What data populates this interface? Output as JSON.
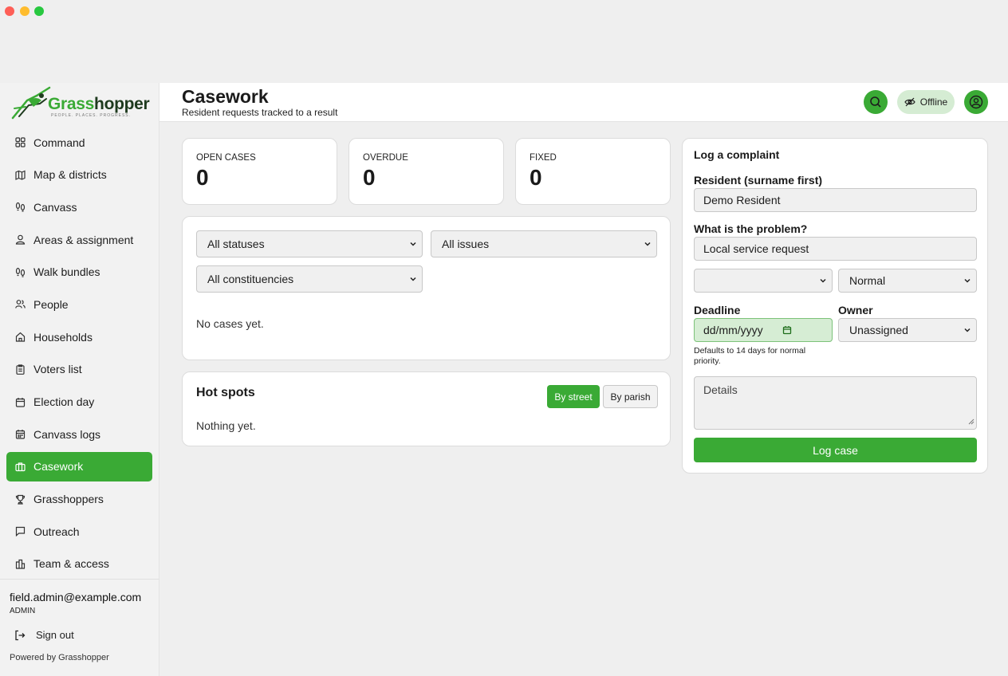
{
  "app": {
    "logo_text_accent": "Grass",
    "logo_text_main": "hopper",
    "logo_tagline": "PEOPLE. PLACES. PROGRESS."
  },
  "sidebar": {
    "items": [
      {
        "label": "Command",
        "icon": "grid-icon"
      },
      {
        "label": "Map & districts",
        "icon": "map-icon"
      },
      {
        "label": "Canvass",
        "icon": "footprints-icon"
      },
      {
        "label": "Areas & assignment",
        "icon": "user-pin-icon"
      },
      {
        "label": "Walk bundles",
        "icon": "footprints-icon"
      },
      {
        "label": "People",
        "icon": "users-icon"
      },
      {
        "label": "Households",
        "icon": "home-icon"
      },
      {
        "label": "Voters list",
        "icon": "clipboard-icon"
      },
      {
        "label": "Election day",
        "icon": "calendar-icon"
      },
      {
        "label": "Canvass logs",
        "icon": "calendar-grid-icon"
      },
      {
        "label": "Casework",
        "icon": "briefcase-icon",
        "active": true
      },
      {
        "label": "Grasshoppers",
        "icon": "trophy-icon"
      },
      {
        "label": "Outreach",
        "icon": "message-square-icon"
      },
      {
        "label": "Team & access",
        "icon": "building-icon"
      }
    ],
    "user_email": "field.admin@example.com",
    "user_role": "ADMIN",
    "sign_out": "Sign out",
    "powered_by": "Powered by Grasshopper"
  },
  "header": {
    "title": "Casework",
    "subtitle": "Resident requests tracked to a result",
    "offline_label": "Offline"
  },
  "stats": [
    {
      "label": "OPEN CASES",
      "value": "0"
    },
    {
      "label": "OVERDUE",
      "value": "0"
    },
    {
      "label": "FIXED",
      "value": "0"
    }
  ],
  "filters": {
    "status": "All statuses",
    "issue": "All issues",
    "constituency": "All constituencies",
    "empty": "No cases yet."
  },
  "hotspots": {
    "title": "Hot spots",
    "by_street": "By street",
    "by_parish": "By parish",
    "empty": "Nothing yet."
  },
  "form": {
    "title": "Log a complaint",
    "resident_label": "Resident (surname first)",
    "resident_value": "Demo Resident",
    "problem_label": "What is the problem?",
    "problem_value": "Local service request",
    "category_value": "",
    "priority_value": "Normal",
    "deadline_label": "Deadline",
    "deadline_placeholder": "dd/mm/yyyy",
    "owner_label": "Owner",
    "owner_value": "Unassigned",
    "deadline_hint": "Defaults to 14 days for normal priority.",
    "details_placeholder": "Details",
    "submit": "Log case"
  },
  "colors": {
    "accent": "#3aaa35",
    "accent_soft": "#d5ecd3"
  }
}
